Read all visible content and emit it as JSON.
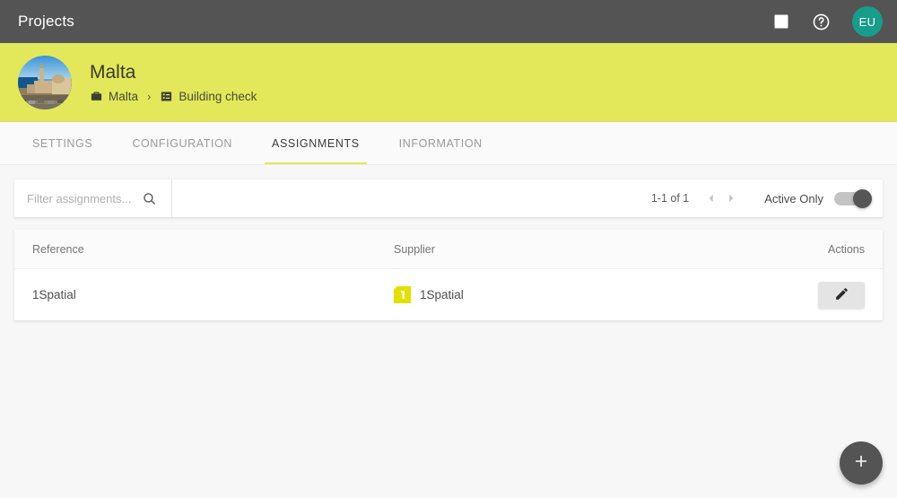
{
  "topbar": {
    "title": "Projects",
    "chart_icon": "bar-chart-icon",
    "help_icon": "help-icon",
    "avatar_initials": "EU",
    "avatar_color": "#179d8c",
    "background": "#545454"
  },
  "project_header": {
    "background": "#e2e85a",
    "thumbnail_alt": "malta-coastal-photo",
    "title": "Malta",
    "breadcrumb": [
      {
        "icon": "briefcase-icon",
        "label": "Malta"
      },
      {
        "icon": "list-alt-icon",
        "label": "Building check"
      }
    ],
    "separator": "›"
  },
  "tabs": [
    {
      "label": "SETTINGS",
      "active": false
    },
    {
      "label": "CONFIGURATION",
      "active": false
    },
    {
      "label": "ASSIGNMENTS",
      "active": true
    },
    {
      "label": "INFORMATION",
      "active": false
    }
  ],
  "toolbar": {
    "filter_placeholder": "Filter assignments...",
    "filter_value": "",
    "search_icon": "search-icon",
    "pagination": "1-1 of 1",
    "prev_icon": "chevron-left-icon",
    "next_icon": "chevron-right-icon",
    "toggle_label": "Active Only",
    "toggle_on": true
  },
  "table": {
    "columns": [
      "Reference",
      "Supplier",
      "Actions"
    ],
    "rows": [
      {
        "reference": "1Spatial",
        "supplier": "1Spatial",
        "supplier_logo": "1spatial-logo",
        "supplier_logo_color": "#e3e000",
        "action_icon": "edit-pencil-icon"
      }
    ]
  },
  "fab": {
    "icon": "plus-icon",
    "label": "+",
    "color": "#545454"
  }
}
